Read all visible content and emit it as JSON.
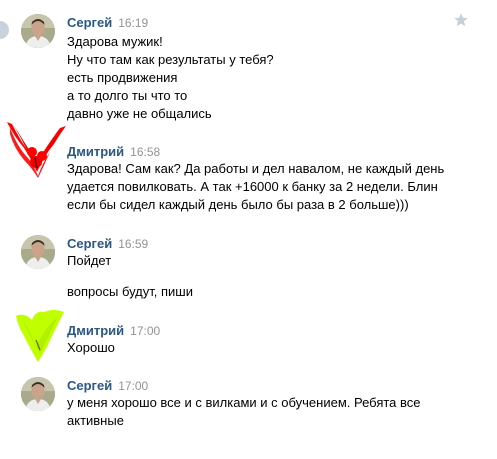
{
  "messages": [
    {
      "author": "Сергей",
      "time": "16:19",
      "lines": [
        "Здарова мужик!",
        "Ну что там как результаты у тебя?",
        "есть продвижения",
        "а то долго ты что то",
        "давно уже не общались"
      ]
    },
    {
      "author": "Дмитрий",
      "time": "16:58",
      "lines": [
        "Здарова! Сам как? Да работы и дел навалом, не каждый день",
        "удается повилковать. А так +16000 к банку за 2 недели. Блин",
        "если бы сидел каждый день было бы раза в 2 больше)))"
      ]
    },
    {
      "author": "Сергей",
      "time": "16:59",
      "lines": [
        "Пойдет"
      ],
      "followup": "вопросы будут, пиши"
    },
    {
      "author": "Дмитрий",
      "time": "17:00",
      "lines": [
        "Хорошо"
      ]
    },
    {
      "author": "Сергей",
      "time": "17:00",
      "lines": [
        "у меня хорошо все и с вилками и с обучением. Ребята все",
        "активные"
      ]
    }
  ],
  "icons": {
    "favorite": "star-icon",
    "status": "status-dot-icon"
  },
  "colors": {
    "author_link": "#2a5885",
    "time": "#939393",
    "star": "#c5d0db",
    "red_scribble": "#ff0000",
    "green_scribble": "#bfff00"
  }
}
